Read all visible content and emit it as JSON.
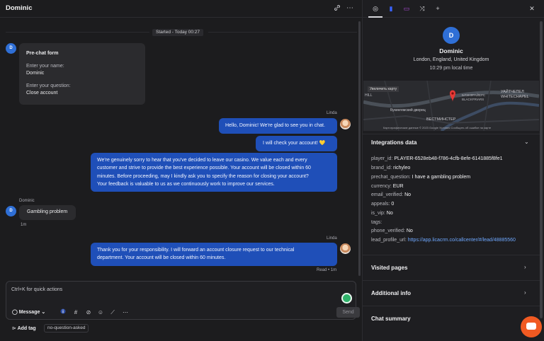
{
  "header": {
    "title": "Dominic",
    "link_icon": "link-icon",
    "more_icon": "more-horizontal-icon"
  },
  "separator": {
    "label": "Started - Today 00:27"
  },
  "prechat": {
    "avatar": "D",
    "title": "Pre-chat form",
    "q1": "Enter your name:",
    "a1": "Dominic",
    "q2": "Enter your question:",
    "a2": "Close account"
  },
  "messages": {
    "agent_name_1": "Linda",
    "m1": "Hello, Dominic! We're glad to see you in chat.",
    "m2": "I will check your account! 💛",
    "m3_lines": [
      "We're genuinely sorry to hear that you've decided to leave our casino. We value each and every",
      "customer and strive to provide the best experience possible. Your account will be closed within 60",
      "minutes. Before proceeding, may I kindly ask you to specify the reason for closing your account?",
      "Your feedback is valuable to us as we continuously work to improve our services."
    ],
    "customer_name": "Dominic",
    "customer_avatar": "D",
    "m4": "Gambling problem",
    "m4_time": "1m",
    "agent_name_2": "Linda",
    "m5_lines": [
      "Thank you for your responsibility. I will forward an account closure request to our technical",
      "department. Your account will be closed within 60 minutes."
    ],
    "m5_status": "Read • 1m"
  },
  "composer": {
    "placeholder": "Ctrl+K for quick actions",
    "message_label": "Message",
    "send_label": "Send",
    "add_tag_label": "Add tag",
    "tag": "no-question-asked"
  },
  "details": {
    "avatar": "D",
    "name": "Dominic",
    "location": "London, England, United Kingdom",
    "local_time": "10:29 pm local time",
    "map": {
      "enlarge_label": "Увеличить карту",
      "labels": [
        "УАЙТЧЕПЕЛ",
        "WHITECHAPEL",
        "БЛЭКФРАЙЕРС",
        "BLACKFRIARS",
        "Букингемский дворец",
        "ВЕСТМИНСТЕР",
        "HILL"
      ],
      "footer": "Картографические данные © 2023 Google    Условия    Сообщить об ошибке на карте"
    },
    "integrations_title": "Integrations data",
    "fields": [
      {
        "key": "player_id:",
        "value": "PLAYER-6528eb48-f786-4cfb-8efe-6141885f8fe1"
      },
      {
        "key": "brand_id:",
        "value": "richyleo"
      },
      {
        "key": "prechat_question:",
        "value": "I have a gambling problem"
      },
      {
        "key": "currency:",
        "value": "EUR"
      },
      {
        "key": "email_verified:",
        "value": "No"
      },
      {
        "key": "appeals:",
        "value": "0"
      },
      {
        "key": "is_vip:",
        "value": "No"
      },
      {
        "key": "tags:",
        "value": ""
      },
      {
        "key": "phone_verified:",
        "value": "No"
      },
      {
        "key": "lead_profile_url:",
        "value": "https://app.licacrm.co/callcenter/#/lead/48885560"
      }
    ],
    "sections": [
      "Visited pages",
      "Additional info",
      "Chat summary"
    ]
  },
  "colors": {
    "accent": "#1f4fb8",
    "avatar": "#2f6fd6",
    "link": "#6ea8ff",
    "fab": "#f15a22"
  }
}
